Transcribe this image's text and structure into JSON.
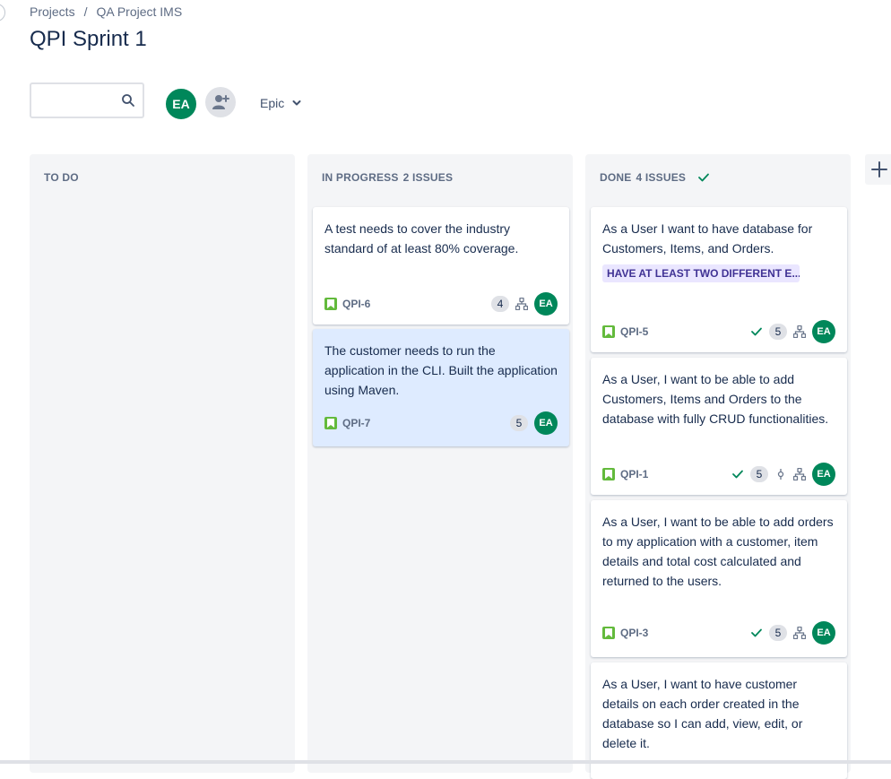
{
  "breadcrumb": {
    "root": "Projects",
    "separator": "/",
    "project": "QA Project IMS"
  },
  "page_title": "QPI Sprint 1",
  "toolbar": {
    "search_placeholder": "",
    "user_avatar": "EA",
    "epic_filter_label": "Epic"
  },
  "columns": [
    {
      "title": "TO DO",
      "count_label": "",
      "done": false,
      "cards": []
    },
    {
      "title": "IN PROGRESS",
      "count_label": "2 ISSUES",
      "done": false,
      "cards": [
        {
          "summary": "A test needs to cover the industry standard of at least 80% coverage.",
          "key": "QPI-6",
          "points": "4",
          "assignee": "EA",
          "selected": false
        },
        {
          "summary": "The customer needs to run the application in the CLI. Built the application using Maven.",
          "key": "QPI-7",
          "points": "5",
          "assignee": "EA",
          "selected": true
        }
      ]
    },
    {
      "title": "DONE",
      "count_label": "4 ISSUES",
      "done": true,
      "cards": [
        {
          "summary": "As a User I want to have database for Customers, Items, and Orders.",
          "epic": "HAVE AT LEAST TWO DIFFERENT E...",
          "key": "QPI-5",
          "points": "5",
          "assignee": "EA"
        },
        {
          "summary": "As a User, I want to be able to add Customers, Items and Orders to the database with fully CRUD functionalities.",
          "key": "QPI-1",
          "points": "5",
          "assignee": "EA"
        },
        {
          "summary": "As a User, I want to be able to add orders to my application with a customer, item details and total cost calculated and returned to the users.",
          "key": "QPI-3",
          "points": "5",
          "assignee": "EA"
        },
        {
          "summary": "As a User, I want to have customer details on each order created in the database so I can add, view, edit, or delete it."
        }
      ]
    }
  ],
  "colors": {
    "avatar": "#00875a",
    "story_icon": "#63ba3c",
    "done_check": "#00875a",
    "column_bg": "#f4f5f7",
    "selected_card": "#deebff",
    "epic_label_bg": "#eae6ff",
    "epic_label_text": "#403294"
  },
  "icons": {
    "search": "search-icon",
    "add_people": "add-people-icon",
    "epic_dropdown": "chevron-down-icon",
    "story": "story-icon",
    "subtasks": "subtasks-icon",
    "commit": "commit-icon",
    "done": "check-icon",
    "add_column": "plus-icon"
  }
}
